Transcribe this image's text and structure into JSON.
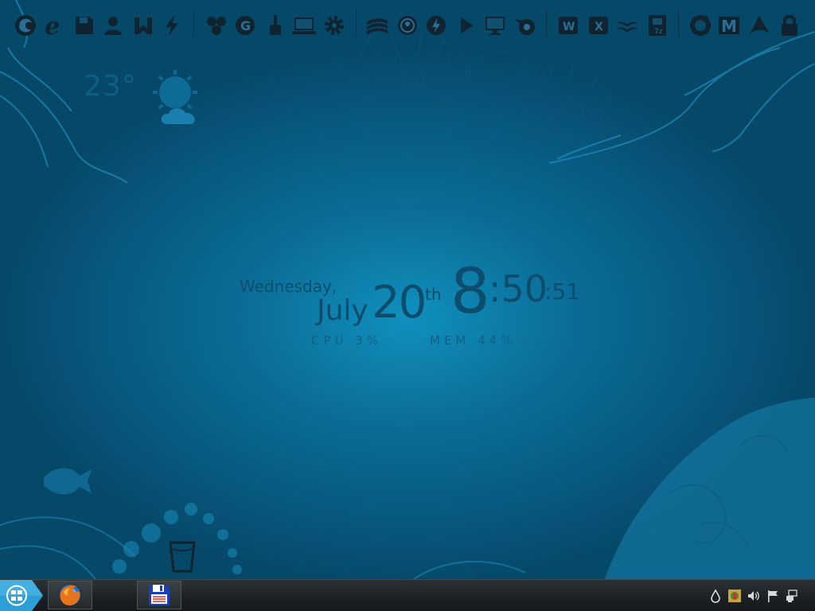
{
  "weather": {
    "temperature": "23°",
    "icon": "sun-behind-cloud-icon"
  },
  "clock": {
    "day": "Wednesday,",
    "month": "July",
    "date": "20",
    "date_suffix": "th",
    "hour": "8",
    "minutes": ":50",
    "seconds": ":51"
  },
  "system_monitor": {
    "cpu": "CPU 3%",
    "mem": "MEM 44%"
  },
  "dock": {
    "groups": [
      [
        "firefox-icon",
        "ie-icon",
        "save-icon",
        "user-icon",
        "torrent-icon",
        "flash-icon"
      ],
      [
        "settings-group-icon",
        "google-icon",
        "brush-icon",
        "laptop-icon",
        "gear-icon"
      ],
      [
        "winamp-icon",
        "media-icon",
        "thunder-icon",
        "play-icon",
        "monitor-icon",
        "blender-icon"
      ],
      [
        "word-icon",
        "excel-icon",
        "wine-icon",
        "zip-icon"
      ],
      [
        "refresh-icon",
        "m-icon",
        "acrobat-icon",
        "lock-icon"
      ]
    ]
  },
  "colors": {
    "accent": "#0a6d97",
    "icon": "#0f2430",
    "taskbar": "#1b2024"
  },
  "taskbar": {
    "start_icon": "windows-start-icon",
    "buttons": [
      "firefox-icon",
      "floppy-save-icon"
    ],
    "tray": [
      "water-drop-icon",
      "network-colorful-icon",
      "volume-icon",
      "flag-icon",
      "network-icon"
    ]
  }
}
